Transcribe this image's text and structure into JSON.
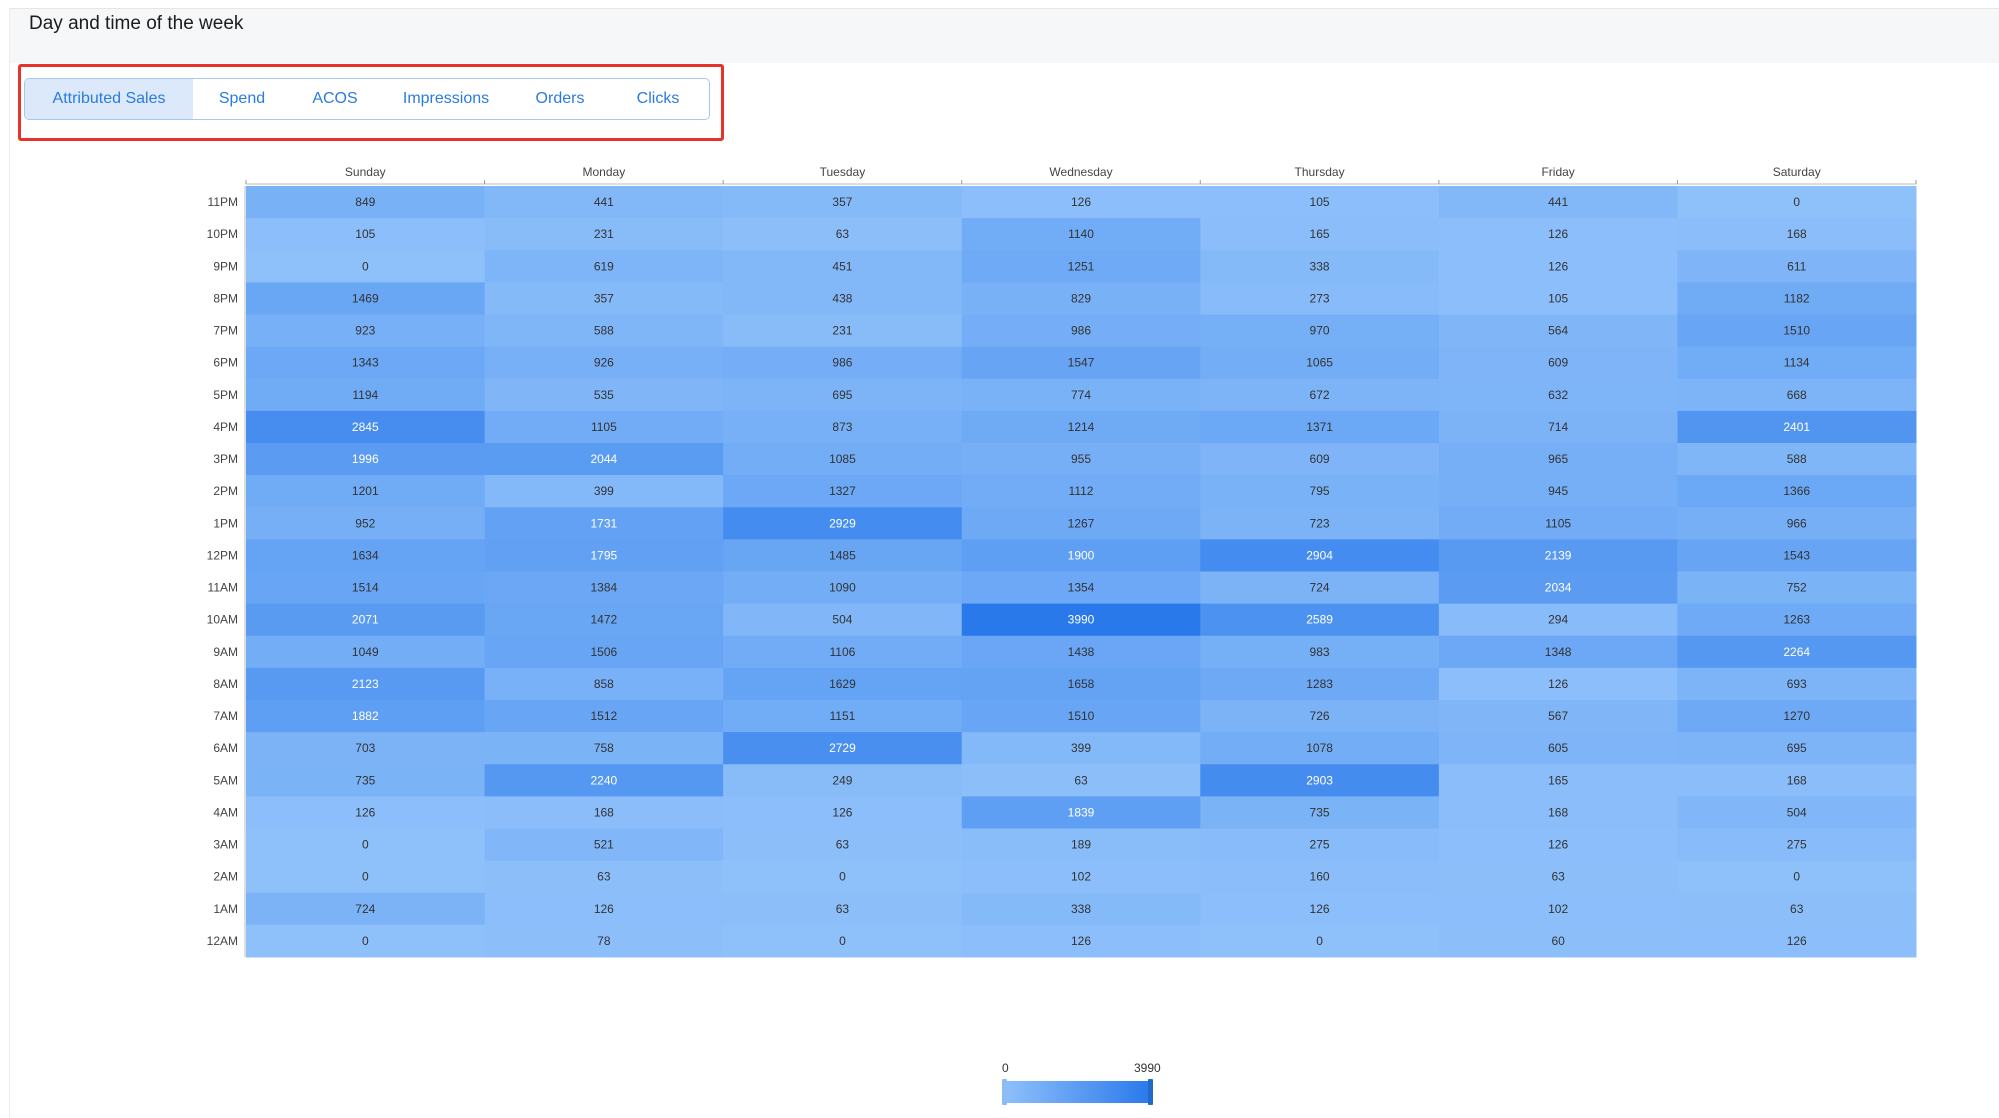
{
  "header": {
    "title": "Day and time of the week"
  },
  "tabs": [
    {
      "label": "Attributed Sales",
      "active": true
    },
    {
      "label": "Spend",
      "active": false
    },
    {
      "label": "ACOS",
      "active": false
    },
    {
      "label": "Impressions",
      "active": false
    },
    {
      "label": "Orders",
      "active": false
    },
    {
      "label": "Clicks",
      "active": false
    }
  ],
  "colors": {
    "low": "#8ec0fa",
    "high": "#2979eb",
    "tab_text": "#2a7be0",
    "highlight_box": "#e8332a"
  },
  "legend": {
    "min_label": "0",
    "max_label": "3990"
  },
  "chart_data": {
    "type": "heatmap",
    "title": "",
    "x_categories": [
      "Sunday",
      "Monday",
      "Tuesday",
      "Wednesday",
      "Thursday",
      "Friday",
      "Saturday"
    ],
    "y_categories": [
      "11PM",
      "10PM",
      "9PM",
      "8PM",
      "7PM",
      "6PM",
      "5PM",
      "4PM",
      "3PM",
      "2PM",
      "1PM",
      "12PM",
      "11AM",
      "10AM",
      "9AM",
      "8AM",
      "7AM",
      "6AM",
      "5AM",
      "4AM",
      "3AM",
      "2AM",
      "1AM",
      "12AM"
    ],
    "values": [
      [
        849,
        441,
        357,
        126,
        105,
        441,
        0
      ],
      [
        105,
        231,
        63,
        1140,
        165,
        126,
        168
      ],
      [
        0,
        619,
        451,
        1251,
        338,
        126,
        611
      ],
      [
        1469,
        357,
        438,
        829,
        273,
        105,
        1182
      ],
      [
        923,
        588,
        231,
        986,
        970,
        564,
        1510
      ],
      [
        1343,
        926,
        986,
        1547,
        1065,
        609,
        1134
      ],
      [
        1194,
        535,
        695,
        774,
        672,
        632,
        668
      ],
      [
        2845,
        1105,
        873,
        1214,
        1371,
        714,
        2401
      ],
      [
        1996,
        2044,
        1085,
        955,
        609,
        965,
        588
      ],
      [
        1201,
        399,
        1327,
        1112,
        795,
        945,
        1366
      ],
      [
        952,
        1731,
        2929,
        1267,
        723,
        1105,
        966
      ],
      [
        1634,
        1795,
        1485,
        1900,
        2904,
        2139,
        1543
      ],
      [
        1514,
        1384,
        1090,
        1354,
        724,
        2034,
        752
      ],
      [
        2071,
        1472,
        504,
        3990,
        2589,
        294,
        1263
      ],
      [
        1049,
        1506,
        1106,
        1438,
        983,
        1348,
        2264
      ],
      [
        2123,
        858,
        1629,
        1658,
        1283,
        126,
        693
      ],
      [
        1882,
        1512,
        1151,
        1510,
        726,
        567,
        1270
      ],
      [
        703,
        758,
        2729,
        399,
        1078,
        605,
        695
      ],
      [
        735,
        2240,
        249,
        63,
        2903,
        165,
        168
      ],
      [
        126,
        168,
        126,
        1839,
        735,
        168,
        504
      ],
      [
        0,
        521,
        63,
        189,
        275,
        126,
        275
      ],
      [
        0,
        63,
        0,
        102,
        160,
        63,
        0
      ],
      [
        724,
        126,
        63,
        338,
        126,
        102,
        63
      ],
      [
        0,
        78,
        0,
        126,
        0,
        60,
        126
      ]
    ],
    "value_range": [
      0,
      3990
    ],
    "legend": "bottom-center"
  }
}
